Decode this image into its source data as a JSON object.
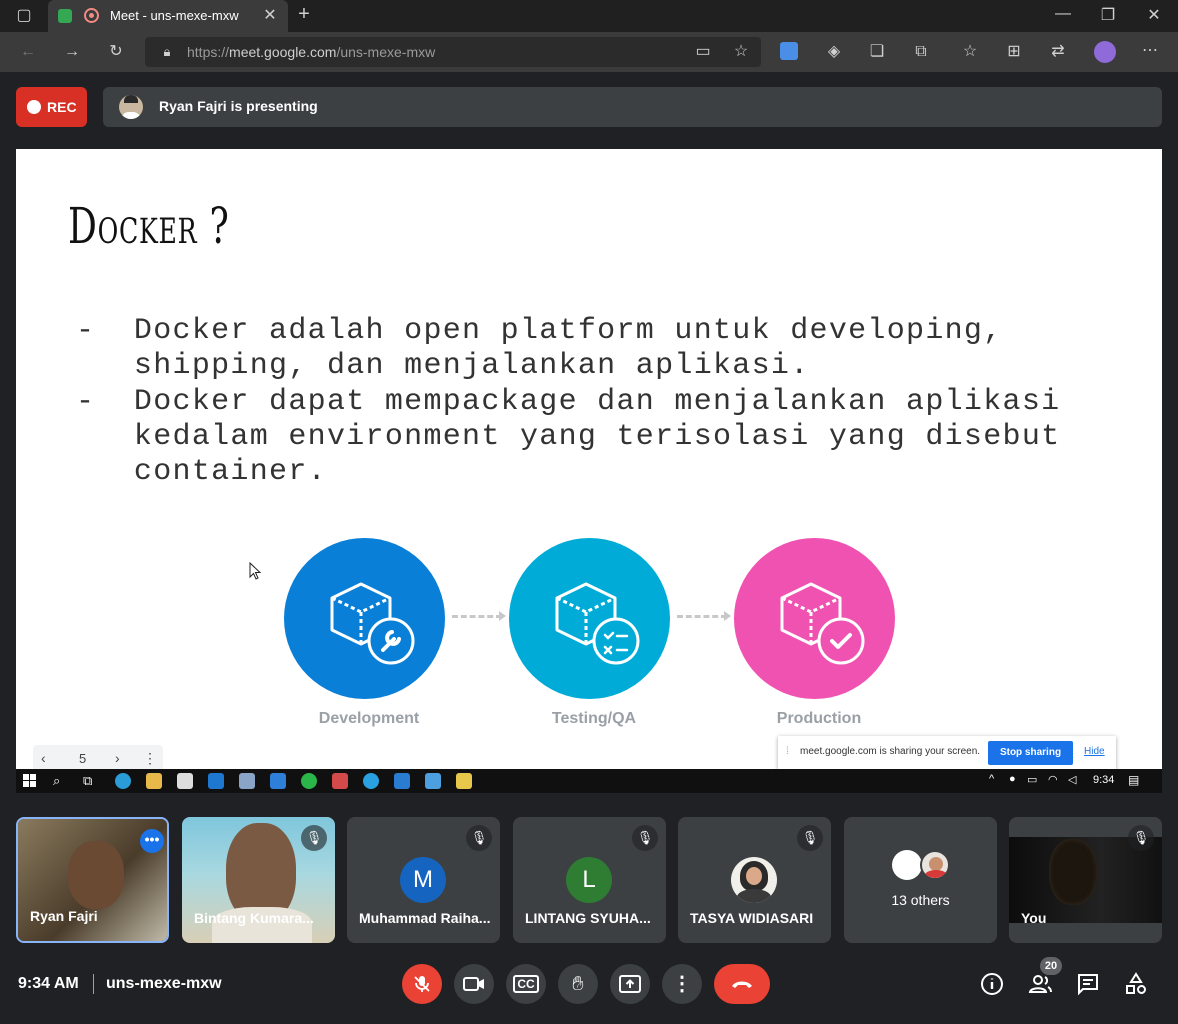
{
  "browser": {
    "tab_title": "Meet - uns-mexe-mxw",
    "url_prefix": "https://",
    "url_host": "meet.google.com",
    "url_path": "/uns-mexe-mxw"
  },
  "meet": {
    "rec_label": "REC",
    "presenting_text": "Ryan Fajri is presenting"
  },
  "slide": {
    "title": "Docker ?",
    "bullets": [
      "-  Docker adalah open platform untuk developing,\n   shipping, dan menjalankan aplikasi.",
      "-  Docker dapat mempackage dan menjalankan aplikasi\n   kedalam environment yang terisolasi yang disebut\n   container."
    ],
    "stages": [
      "Development",
      "Testing/QA",
      "Production"
    ],
    "stage_colors": [
      "#0a7fd8",
      "#00acd7",
      "#f052b1"
    ],
    "page_number": "5"
  },
  "share_notice": {
    "text": "meet.google.com is sharing your screen.",
    "stop_label": "Stop sharing",
    "hide_label": "Hide"
  },
  "taskbar": {
    "time": "9:34"
  },
  "participants": [
    {
      "name": "Ryan Fajri",
      "type": "video",
      "muted": false
    },
    {
      "name": "Bintang Kumara...",
      "type": "video",
      "muted": true
    },
    {
      "name": "Muhammad Raiha...",
      "type": "letter",
      "letter": "M",
      "color": "#1565c0",
      "muted": true
    },
    {
      "name": "LINTANG SYUHA...",
      "type": "letter",
      "letter": "L",
      "color": "#2e7d32",
      "muted": true
    },
    {
      "name": "TASYA WIDIASARI",
      "type": "photo",
      "muted": true
    },
    {
      "name": "13 others",
      "type": "others"
    },
    {
      "name": "You",
      "type": "video",
      "muted": true
    }
  ],
  "bottom": {
    "time": "9:34 AM",
    "meeting_code": "uns-mexe-mxw",
    "people_count": "20"
  }
}
